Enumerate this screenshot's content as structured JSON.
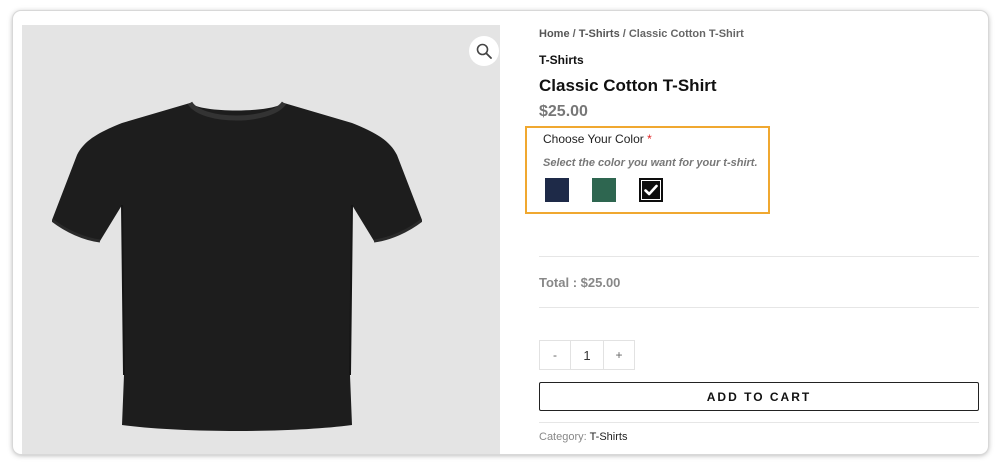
{
  "breadcrumb": {
    "home": "Home",
    "separator": " / ",
    "category": "T-Shirts",
    "current": "Classic Cotton T-Shirt"
  },
  "product": {
    "category": "T-Shirts",
    "title": "Classic Cotton T-Shirt",
    "price": "$25.00"
  },
  "color_option": {
    "label": "Choose Your Color",
    "required_mark": "*",
    "help_text": "Select the color you want for your t-shirt.",
    "swatches": [
      {
        "name": "navy",
        "color": "#1e2a48",
        "selected": false
      },
      {
        "name": "green",
        "color": "#2e6650",
        "selected": false
      },
      {
        "name": "black",
        "color": "#0d0d0d",
        "selected": true
      }
    ],
    "highlight_color": "#f0a830"
  },
  "total": {
    "label": "Total : ",
    "value": "$25.00"
  },
  "quantity": {
    "decrement": "-",
    "value": "1",
    "increment": "+"
  },
  "add_to_cart": "ADD TO CART",
  "meta": {
    "category_label": "Category: ",
    "category_value": "T-Shirts"
  },
  "gallery": {
    "zoom_icon": "magnifier-icon",
    "image_description": "black-tshirt-product-image"
  }
}
